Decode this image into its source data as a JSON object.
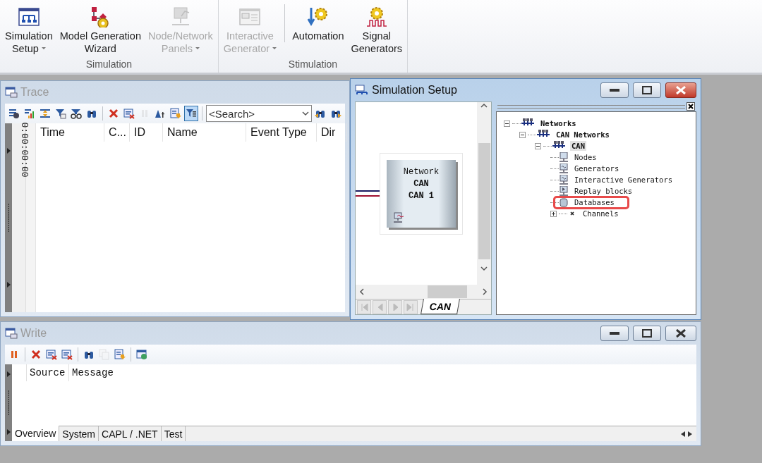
{
  "ribbon": {
    "groups": [
      {
        "label": "Simulation",
        "buttons": [
          {
            "kind": "network-window",
            "lines": [
              "Simulation",
              "Setup"
            ],
            "dropdown": true,
            "disabled": false,
            "separator_before": false
          },
          {
            "kind": "diagram-gear",
            "lines": [
              "Model Generation",
              "Wizard"
            ],
            "dropdown": false,
            "disabled": false,
            "separator_before": false
          },
          {
            "kind": "monitor",
            "lines": [
              "Node/Network",
              "Panels"
            ],
            "dropdown": true,
            "disabled": true,
            "separator_before": false
          }
        ]
      },
      {
        "label": "Stimulation",
        "buttons": [
          {
            "kind": "panel-window",
            "lines": [
              "Interactive",
              "Generator"
            ],
            "dropdown": true,
            "disabled": true,
            "separator_before": false
          },
          {
            "kind": "arrow-gear",
            "lines": [
              "Automation"
            ],
            "dropdown": false,
            "disabled": false,
            "separator_before": true
          },
          {
            "kind": "wave-gear",
            "lines": [
              "Signal",
              "Generators"
            ],
            "dropdown": false,
            "disabled": false,
            "separator_before": false
          }
        ]
      }
    ]
  },
  "windows": {
    "trace": {
      "title": "Trace",
      "active": false,
      "toolbar": [
        {
          "kind": "list-gear",
          "disabled": false,
          "selected": false
        },
        {
          "kind": "bar-chart",
          "disabled": false,
          "selected": false
        },
        {
          "kind": "expand-arrows",
          "disabled": false,
          "selected": false
        },
        {
          "kind": "funnel-mail",
          "disabled": false,
          "selected": false
        },
        {
          "kind": "funnel-glasses",
          "disabled": false,
          "selected": false
        },
        {
          "kind": "binoculars",
          "disabled": false,
          "selected": false
        },
        {
          "kind": "separator"
        },
        {
          "kind": "delete",
          "disabled": false,
          "selected": false
        },
        {
          "kind": "clear-list",
          "disabled": false,
          "selected": false
        },
        {
          "kind": "pause",
          "disabled": true,
          "selected": false
        },
        {
          "kind": "font-size",
          "disabled": false,
          "selected": false
        },
        {
          "kind": "import",
          "disabled": false,
          "selected": false
        },
        {
          "kind": "funnel",
          "disabled": false,
          "selected": true
        },
        {
          "kind": "separator"
        }
      ],
      "search": {
        "placeholder": "<Search>"
      },
      "toolbar_after": [
        {
          "kind": "binoculars-left",
          "disabled": false,
          "selected": false
        },
        {
          "kind": "binoculars-right",
          "disabled": false,
          "selected": false
        }
      ],
      "time_axis": "0:00:00:00",
      "columns": [
        "Time",
        "C...",
        "ID",
        "Name",
        "Event Type",
        "Dir"
      ]
    },
    "simulation_setup": {
      "title": "Simulation Setup",
      "active": true,
      "network_block": {
        "lines": [
          {
            "text": "Network",
            "bold": false
          },
          {
            "text": "CAN",
            "bold": true
          },
          {
            "text": "CAN 1",
            "bold": true
          }
        ]
      },
      "tabs": [
        {
          "label": "CAN",
          "selected": true
        }
      ],
      "tree": [
        {
          "label": "Networks",
          "kind": "network",
          "selected": false,
          "expanded": true,
          "children": [
            {
              "label": "CAN Networks",
              "kind": "network",
              "selected": false,
              "expanded": true,
              "children": [
                {
                  "label": "CAN",
                  "kind": "network",
                  "selected": true,
                  "expanded": true,
                  "children": [
                    {
                      "label": "Nodes",
                      "kind": "node",
                      "selected": false
                    },
                    {
                      "label": "Generators",
                      "kind": "generator",
                      "selected": false
                    },
                    {
                      "label": "Interactive Generators",
                      "kind": "generator",
                      "selected": false
                    },
                    {
                      "label": "Replay blocks",
                      "kind": "replay",
                      "selected": false
                    },
                    {
                      "label": "Databases",
                      "kind": "database",
                      "selected": false,
                      "highlighted": true
                    },
                    {
                      "label": "Channels",
                      "kind": "channel",
                      "selected": false,
                      "expanded": false
                    }
                  ]
                }
              ]
            }
          ]
        }
      ]
    },
    "write": {
      "title": "Write",
      "active": false,
      "toolbar": [
        {
          "kind": "pause",
          "disabled": false,
          "selected": false
        },
        {
          "kind": "separator"
        },
        {
          "kind": "delete",
          "disabled": false,
          "selected": false
        },
        {
          "kind": "clear-mail",
          "disabled": false,
          "selected": false
        },
        {
          "kind": "clear-doc",
          "disabled": false,
          "selected": false
        },
        {
          "kind": "separator"
        },
        {
          "kind": "binoculars",
          "disabled": false,
          "selected": false
        },
        {
          "kind": "copy",
          "disabled": true,
          "selected": false
        },
        {
          "kind": "export",
          "disabled": false,
          "selected": false
        },
        {
          "kind": "separator"
        },
        {
          "kind": "globe-window",
          "disabled": false,
          "selected": false
        }
      ],
      "columns": [
        "Source",
        "Message"
      ],
      "tabs": [
        {
          "label": "Overview",
          "selected": true
        },
        {
          "label": "System",
          "selected": false
        },
        {
          "label": "CAPL / .NET",
          "selected": false
        },
        {
          "label": "Test",
          "selected": false
        }
      ]
    }
  }
}
